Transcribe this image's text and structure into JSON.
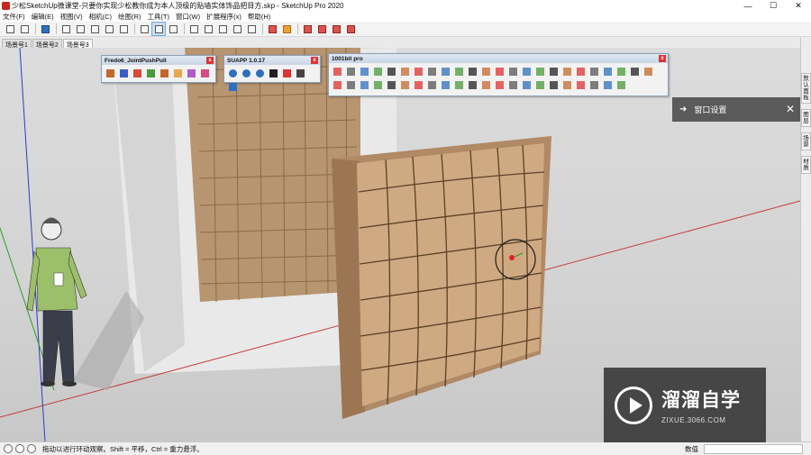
{
  "window": {
    "title": "少松SketchUp微课堂-只要你实现少松教你成为本人顶级的贴墙实体饰品把目方.skp - SketchUp Pro 2020",
    "controls": [
      "—",
      "☐",
      "✕"
    ]
  },
  "menu": [
    "文件(F)",
    "编辑(E)",
    "视图(V)",
    "相机(C)",
    "绘图(R)",
    "工具(T)",
    "窗口(W)",
    "扩展程序(x)",
    "帮助(H)"
  ],
  "scenes": [
    "场景号1",
    "场景号2",
    "场景号3"
  ],
  "panels": {
    "fredo": {
      "title": "Fredo6_JointPushPull",
      "close": "x"
    },
    "second": {
      "title": "SUAPP 1.0.17",
      "close": "x"
    },
    "bit": {
      "title": "1001bit pro",
      "close": "x"
    }
  },
  "side_panel": {
    "pin": "➜",
    "title": "窗口设置",
    "close": "✕"
  },
  "right_tabs": [
    "默认面板",
    "图层",
    "场景",
    "材质"
  ],
  "status": {
    "text": "拖动以进行环动观察。Shift = 平移，Ctrl = 重力悬浮。",
    "measure_label": "数值",
    "measure_value": ""
  },
  "watermark": {
    "name": "溜溜自学",
    "url": "ZIXUE.3066.COM"
  },
  "colors": {
    "accent": "#c8281e",
    "panel_header": "#c9d6e6",
    "side_panel": "#5a5a5a",
    "shelf": "#c9a57f"
  },
  "icons": {
    "toolbar": [
      "select-icon",
      "eraser-icon",
      "paint-icon",
      "line-icon",
      "rect-icon",
      "circle-icon",
      "arc-icon",
      "push-pull-icon",
      "move-icon",
      "rotate-icon",
      "scale-icon",
      "offset-icon",
      "tape-icon",
      "orbit-icon",
      "pan-icon",
      "zoom-icon",
      "zoom-extents-icon",
      "warehouse-icon",
      "component-icon",
      "ruby-icon",
      "gear-icon",
      "red-tool-icon",
      "red-cube-icon",
      "red-folder-icon"
    ]
  }
}
